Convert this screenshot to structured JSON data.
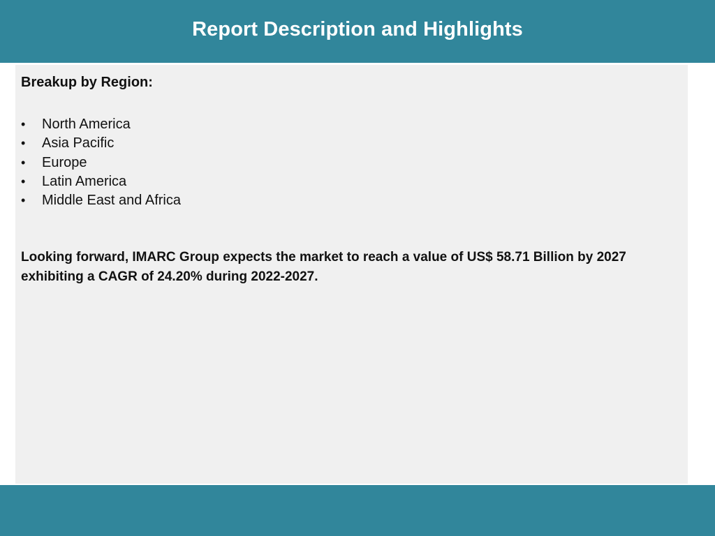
{
  "header": {
    "title": "Report Description and Highlights"
  },
  "content": {
    "heading": "Breakup by Region:",
    "bullet_symbol": "•",
    "regions": [
      "North America",
      "Asia Pacific",
      "Europe",
      "Latin America",
      "Middle East and Africa"
    ],
    "forecast": "Looking forward, IMARC Group expects the market to reach a value of US$ 58.71 Billion by 2027 exhibiting a CAGR of 24.20% during 2022-2027."
  },
  "colors": {
    "brand_bar": "#31869b",
    "panel_background": "#f0f0f0"
  }
}
